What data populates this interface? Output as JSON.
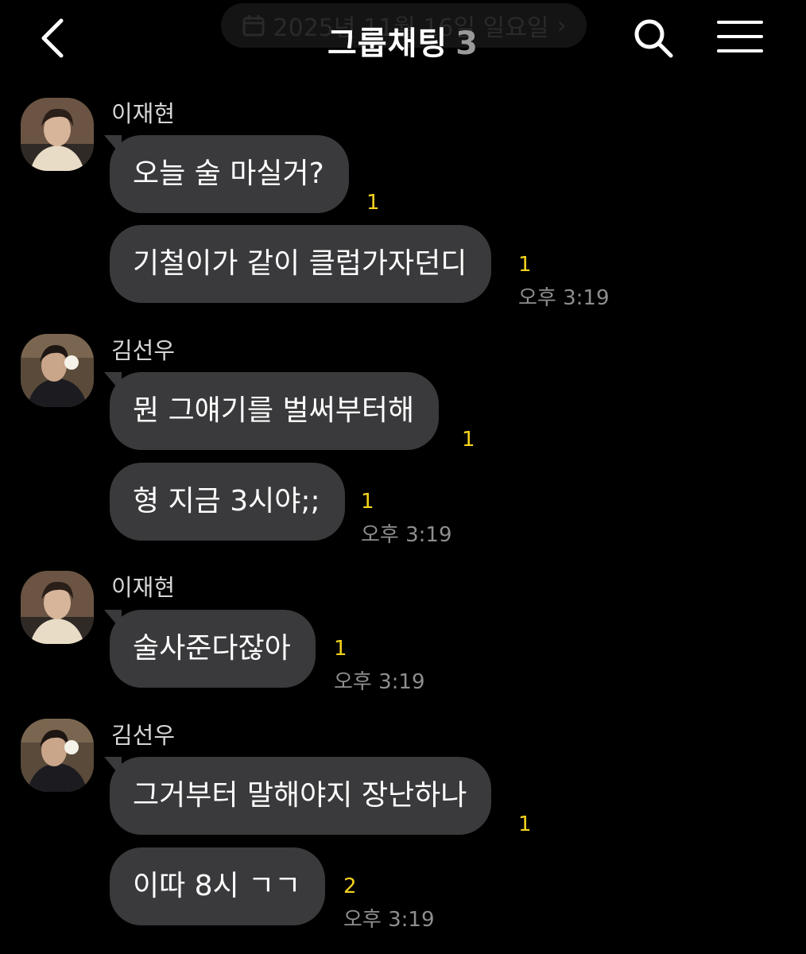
{
  "header": {
    "date_text": "2025년 11월 16일 일요일",
    "date_chevron": "›",
    "title": "그룹채팅",
    "member_count": "3",
    "icons": {
      "back": "chevron-left-icon",
      "search": "search-icon",
      "menu": "hamburger-menu-icon",
      "calendar": "calendar-icon"
    }
  },
  "colors": {
    "background": "#000000",
    "bubble": "#3a3a3c",
    "unread": "#f5d21e",
    "timestamp": "#8e8e8e",
    "sender": "#d6d6d6"
  },
  "groups": [
    {
      "sender": "이재현",
      "messages": [
        {
          "text": "오늘 술 마실거?",
          "unread": "1"
        },
        {
          "text": "기철이가 같이 클럽가자던디",
          "unread": "1",
          "time": "오후 3:19"
        }
      ]
    },
    {
      "sender": "김선우",
      "messages": [
        {
          "text": "뭔 그얘기를 벌써부터해",
          "unread": "1"
        },
        {
          "text": "형 지금 3시야;;",
          "unread": "1",
          "time": "오후 3:19"
        }
      ]
    },
    {
      "sender": "이재현",
      "messages": [
        {
          "text": "술사준다잖아",
          "unread": "1",
          "time": "오후 3:19"
        }
      ]
    },
    {
      "sender": "김선우",
      "messages": [
        {
          "text": "그거부터 말해야지 장난하나",
          "unread": "1"
        },
        {
          "text": "이따 8시 ㄱㄱ",
          "unread": "2",
          "time": "오후 3:19"
        }
      ]
    }
  ]
}
